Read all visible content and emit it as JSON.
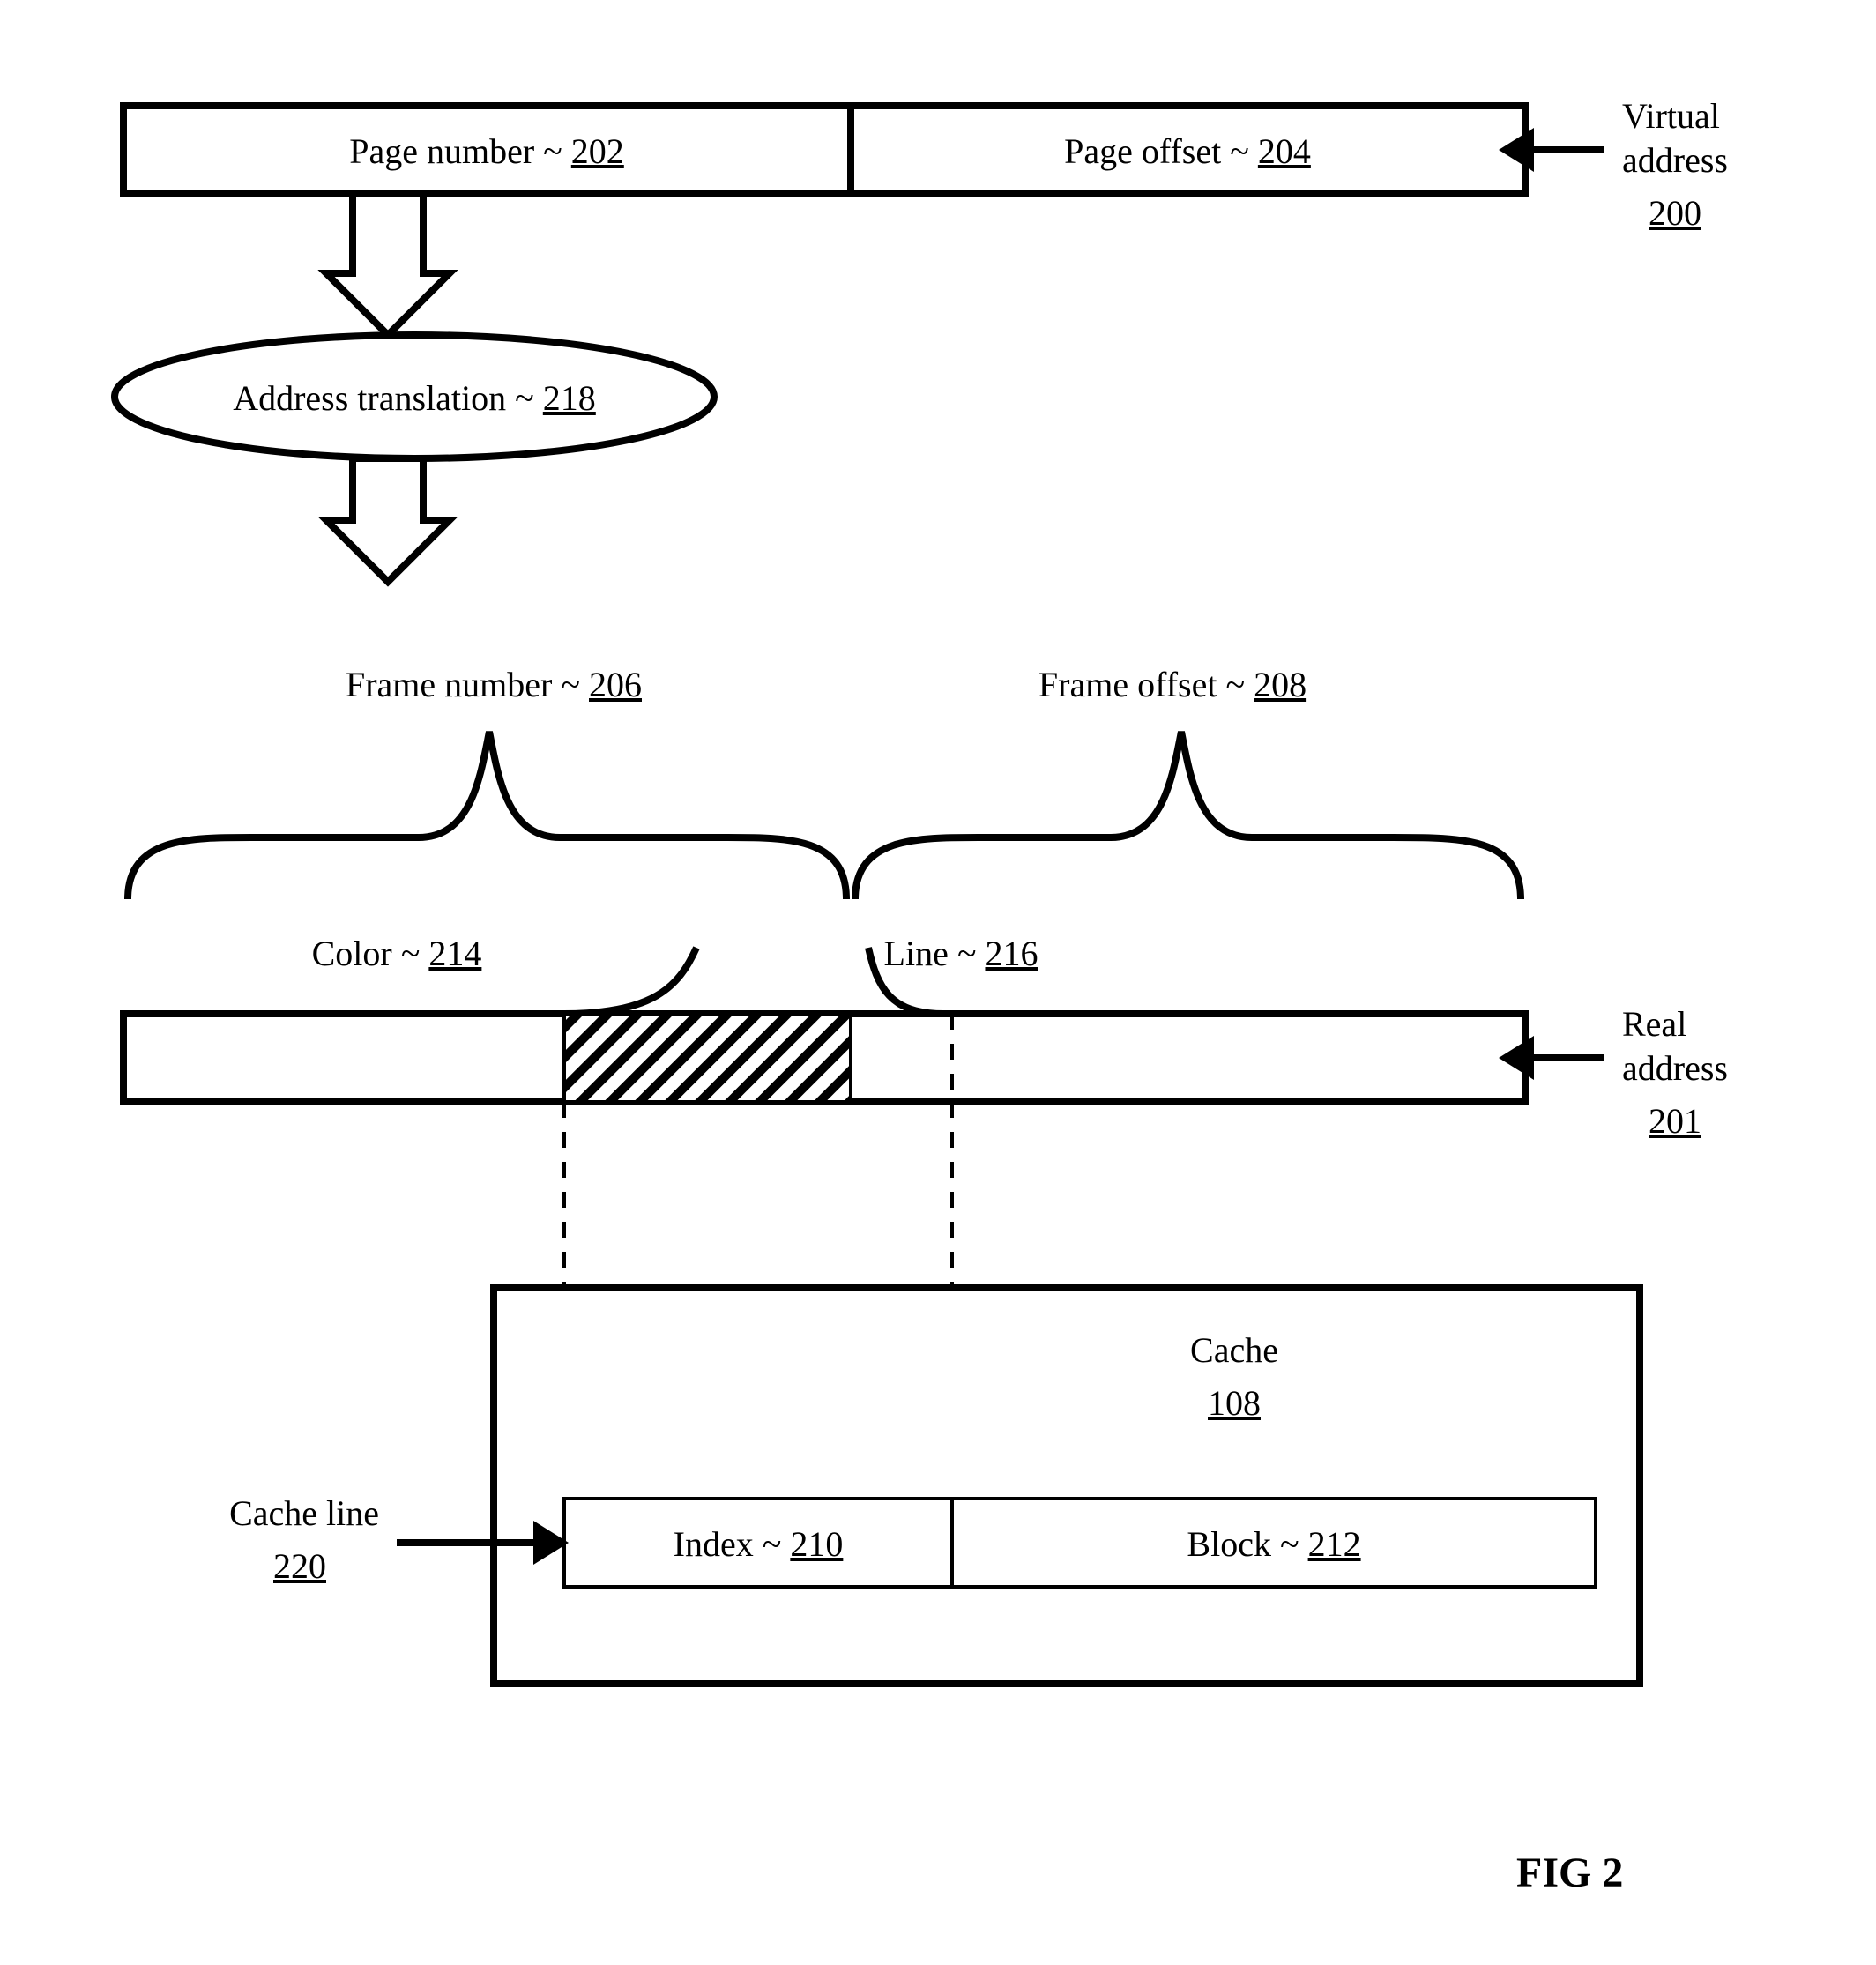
{
  "virtual_address": {
    "page_number": {
      "label": "Page number ~ ",
      "num": "202"
    },
    "page_offset": {
      "label": "Page offset ~ ",
      "num": "204"
    },
    "side": {
      "line1": "Virtual",
      "line2": "address",
      "num": "200"
    }
  },
  "translation": {
    "label": "Address translation ~ ",
    "num": "218"
  },
  "real_address": {
    "frame_number": {
      "label": "Frame number ~ ",
      "num": "206"
    },
    "frame_offset": {
      "label": "Frame offset ~ ",
      "num": "208"
    },
    "color": {
      "label": "Color ~ ",
      "num": "214"
    },
    "line": {
      "label": "Line ~ ",
      "num": "216"
    },
    "side": {
      "line1": "Real",
      "line2": "address",
      "num": "201"
    }
  },
  "cache": {
    "title": "Cache",
    "num": "108",
    "cache_line": {
      "label": "Cache line",
      "num": "220"
    },
    "index": {
      "label": "Index ~ ",
      "num": "210"
    },
    "block": {
      "label": "Block ~ ",
      "num": "212"
    }
  },
  "figure": "FIG 2"
}
